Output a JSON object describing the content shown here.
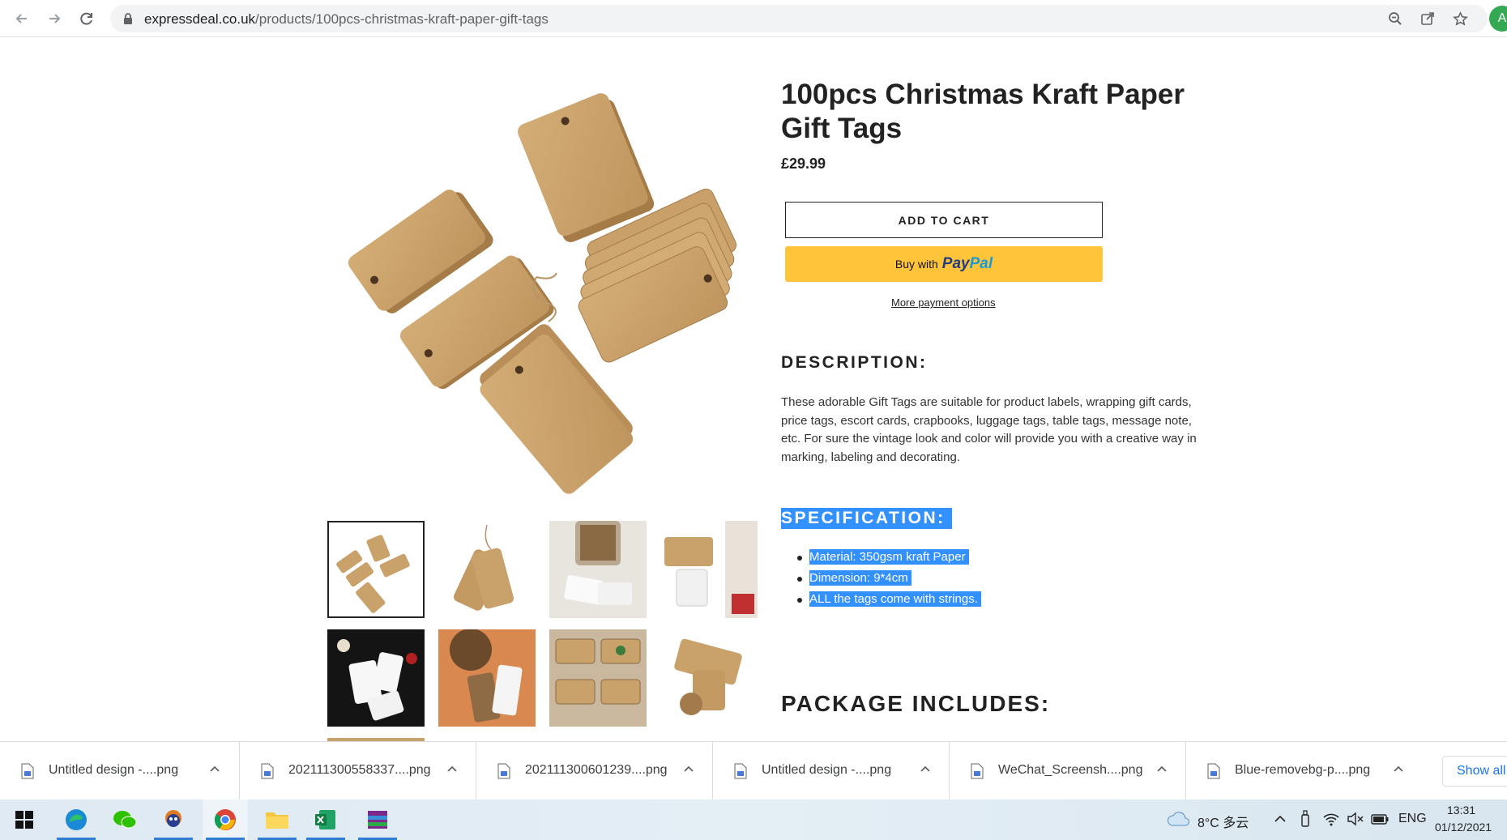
{
  "browser": {
    "url_host": "expressdeal.co.uk",
    "url_path": "/products/100pcs-christmas-kraft-paper-gift-tags",
    "profile_initial": "A"
  },
  "product": {
    "title": "100pcs Christmas Kraft Paper Gift Tags",
    "price": "£29.99",
    "add_to_cart": "ADD TO CART",
    "paypal_buy_with": "Buy with",
    "paypal_brand_1": "Pay",
    "paypal_brand_2": "Pal",
    "more_payment_options": "More payment options",
    "description_heading": "DESCRIPTION:",
    "description_text": "These adorable Gift Tags are suitable for product labels, wrapping gift cards, price tags, escort cards, crapbooks, luggage tags, table tags, message note, etc. For sure the vintage look and color will provide you with a creative way in marking, labeling and decorating.",
    "specification_heading": "SPECIFICATION:",
    "specifications": [
      "Material: 350gsm kraft Paper",
      "Dimension: 9*4cm",
      "ALL the tags come with strings."
    ],
    "package_heading": "PACKAGE INCLUDES:"
  },
  "downloads": {
    "items": [
      "Untitled design -....png",
      "202111300558337....png",
      "202111300601239....png",
      "Untitled design -....png",
      "WeChat_Screensh....png",
      "Blue-removebg-p....png"
    ],
    "show_all": "Show all"
  },
  "taskbar": {
    "weather": "8°C 多云",
    "language": "ENG",
    "time": "13:31",
    "date": "01/12/2021"
  },
  "colors": {
    "selection": "#3390ff",
    "paypal_yellow": "#ffc439",
    "kraft": "#c9a26b"
  }
}
